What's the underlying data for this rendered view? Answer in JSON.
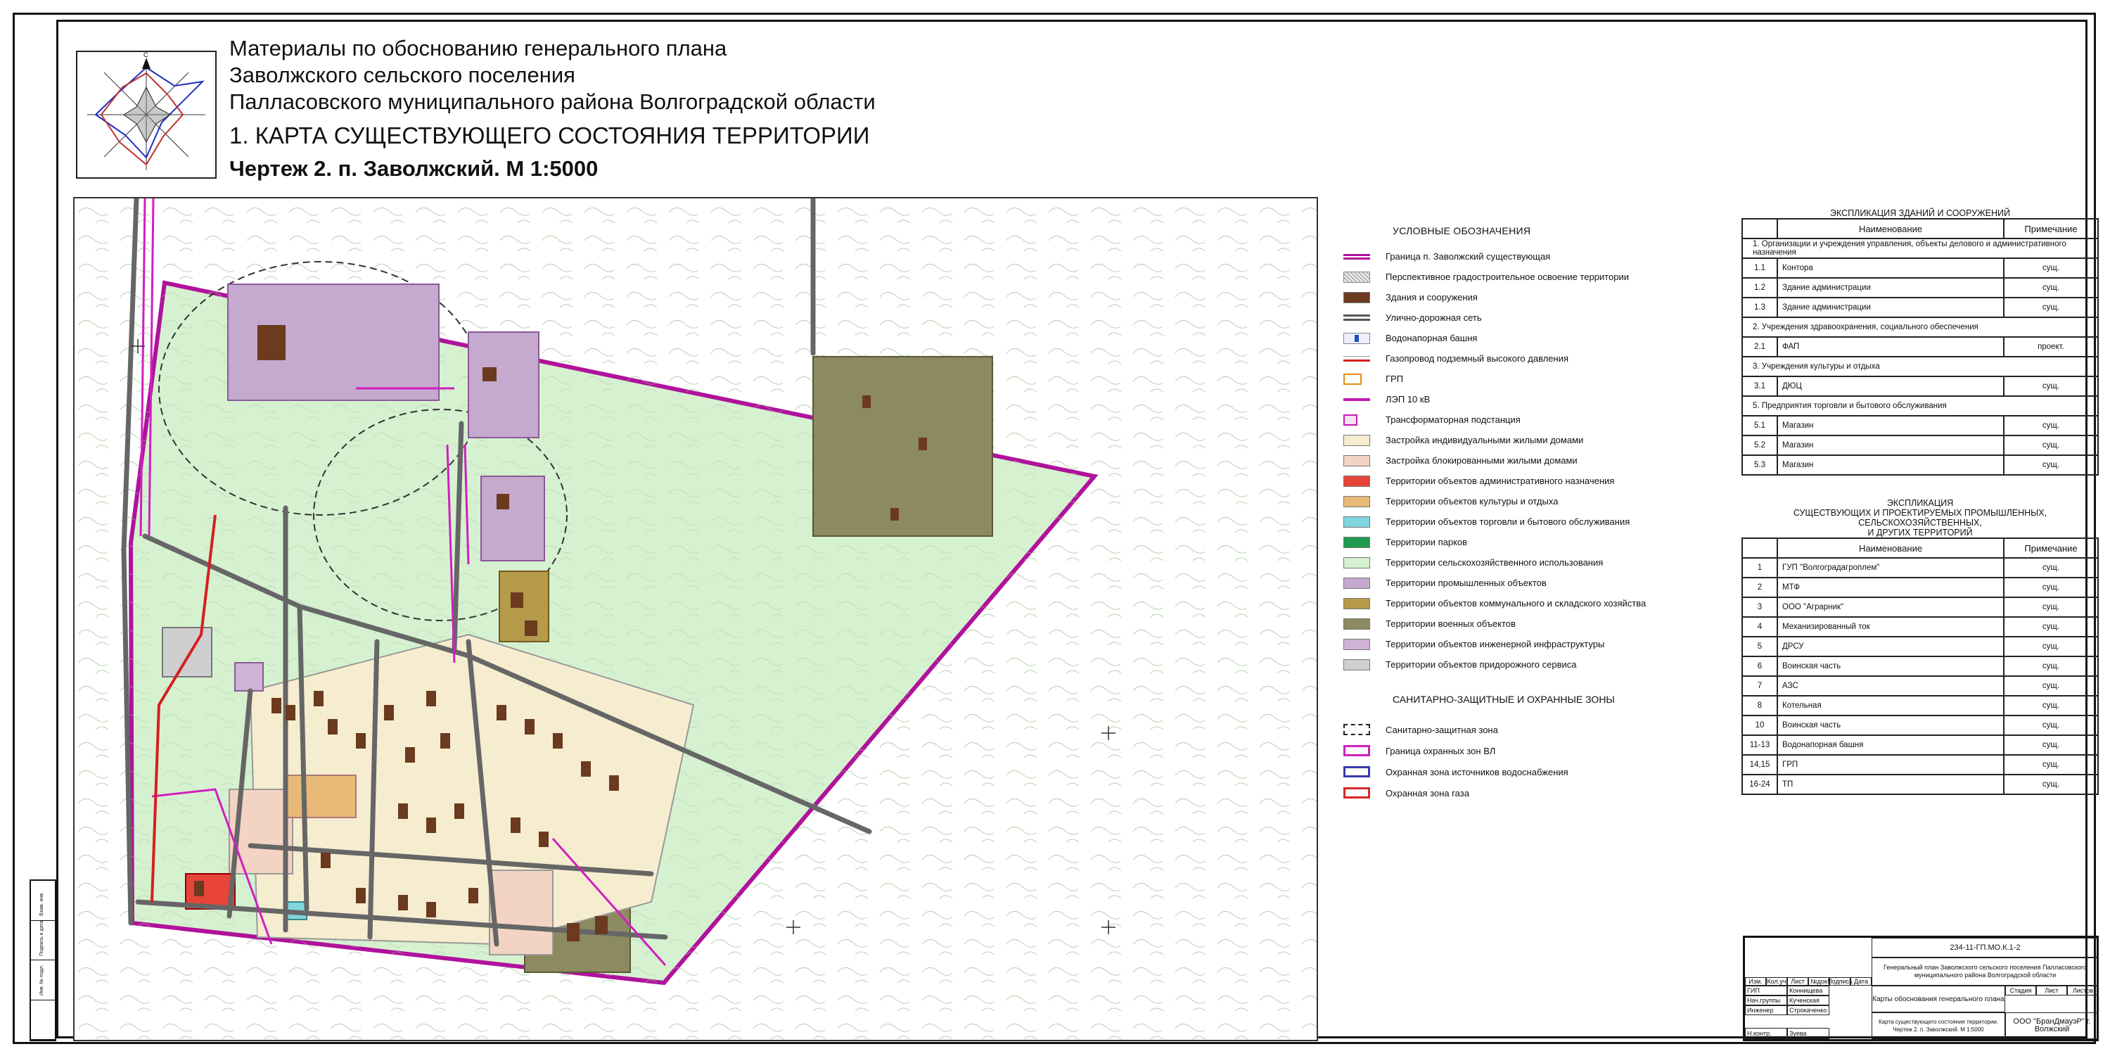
{
  "title": {
    "line1": "Материалы по обоснованию генерального плана",
    "line2": "Заволжского сельского поселения",
    "line3": "Палласовского муниципального района Волгоградской области",
    "map_name": "1. КАРТА СУЩЕСТВУЮЩЕГО СОСТОЯНИЯ ТЕРРИТОРИИ",
    "sheet": "Чертеж 2. п. Заволжский. М 1:5000"
  },
  "wind_rose": {
    "north_label": "С"
  },
  "legend": {
    "heading": "УСЛОВНЫЕ ОБОЗНАЧЕНИЯ",
    "items": [
      {
        "label": "Граница п. Заволжский существующая",
        "swatch": "boundary",
        "color": "#b0129c"
      },
      {
        "label": "Перспективное градостроительное освоение территории",
        "swatch": "hatch",
        "color": "#bdbdbd"
      },
      {
        "label": "Здания и сооружения",
        "swatch": "fill",
        "color": "#6b3a1f"
      },
      {
        "label": "Улично-дорожная сеть",
        "swatch": "road",
        "color": "#555555"
      },
      {
        "label": "Водонапорная башня",
        "swatch": "tower",
        "color": "#1f4fbf"
      },
      {
        "label": "Газопровод подземный высокого давления",
        "swatch": "gas",
        "color": "#d61f1f"
      },
      {
        "label": "ГРП",
        "swatch": "grp",
        "color": "#e38d18"
      },
      {
        "label": "ЛЭП 10 кВ",
        "swatch": "lep",
        "color": "#c21bb0"
      },
      {
        "label": "Трансформаторная подстанция",
        "swatch": "tp",
        "color": "#c21bb0"
      },
      {
        "label": "Застройка индивидуальными жилыми домами",
        "swatch": "fill",
        "color": "#f6edd0"
      },
      {
        "label": "Застройка блокированными жилыми домами",
        "swatch": "fill",
        "color": "#f3d3c3"
      },
      {
        "label": "Территории объектов административного назначения",
        "swatch": "fill",
        "color": "#e8443a"
      },
      {
        "label": "Территории объектов культуры и отдыха",
        "swatch": "fill",
        "color": "#e9b978"
      },
      {
        "label": "Территории объектов торговли и бытового обслуживания",
        "swatch": "fill",
        "color": "#7fd6df"
      },
      {
        "label": "Территории парков",
        "swatch": "fill",
        "color": "#1f9a50"
      },
      {
        "label": "Территории сельскохозяйственного использования",
        "swatch": "fill",
        "color": "#d6f1d0"
      },
      {
        "label": "Территории промышленных объектов",
        "swatch": "fill",
        "color": "#c5a9cf"
      },
      {
        "label": "Территории объектов коммунального и складского хозяйства",
        "swatch": "fill",
        "color": "#b59a4a"
      },
      {
        "label": "Территории военных объектов",
        "swatch": "fill",
        "color": "#8c8a60"
      },
      {
        "label": "Территории объектов инженерной инфраструктуры",
        "swatch": "fill",
        "color": "#cfb3d6"
      },
      {
        "label": "Территории объектов придорожного сервиса",
        "swatch": "fill",
        "color": "#cfcfcf"
      }
    ]
  },
  "zones": {
    "heading": "САНИТАРНО-ЗАЩИТНЫЕ И ОХРАННЫЕ ЗОНЫ",
    "items": [
      {
        "label": "Санитарно-защитная зона",
        "swatch": "dashed",
        "color": "#222222"
      },
      {
        "label": "Граница охранных зон ВЛ",
        "swatch": "outline",
        "color": "#d01fc0"
      },
      {
        "label": "Охранная зона источников водоснабжения",
        "swatch": "outline",
        "color": "#3a3ab0"
      },
      {
        "label": "Охранная зона газа",
        "swatch": "outline",
        "color": "#d62828"
      }
    ]
  },
  "explication_buildings": {
    "title": "ЭКСПЛИКАЦИЯ ЗДАНИЙ И СООРУЖЕНИЙ",
    "col_name": "Наименование",
    "col_note": "Примечание",
    "rows": [
      {
        "section": "1. Организации и учреждения управления, объекты делового и административного назначения"
      },
      {
        "num": "1.1",
        "name": "Контора",
        "note": "сущ."
      },
      {
        "num": "1.2",
        "name": "Здание администрации",
        "note": "сущ."
      },
      {
        "num": "1.3",
        "name": "Здание администрации",
        "note": "сущ."
      },
      {
        "section": "2. Учреждения здравоохранения, социального обеспечения"
      },
      {
        "num": "2.1",
        "name": "ФАП",
        "note": "проект."
      },
      {
        "section": "3. Учреждения культуры и отдыха"
      },
      {
        "num": "3.1",
        "name": "ДЮЦ",
        "note": "сущ."
      },
      {
        "section": "5. Предприятия торговли и бытового обслуживания"
      },
      {
        "num": "5.1",
        "name": "Магазин",
        "note": "сущ."
      },
      {
        "num": "5.2",
        "name": "Магазин",
        "note": "сущ."
      },
      {
        "num": "5.3",
        "name": "Магазин",
        "note": "сущ."
      }
    ]
  },
  "explication_territories": {
    "title_line1": "ЭКСПЛИКАЦИЯ",
    "title_line2": "СУЩЕСТВУЮЩИХ И ПРОЕКТИРУЕМЫХ ПРОМЫШЛЕННЫХ, СЕЛЬСКОХОЗЯЙСТВЕННЫХ,",
    "title_line3": "И ДРУГИХ ТЕРРИТОРИЙ",
    "col_name": "Наименование",
    "col_note": "Примечание",
    "rows": [
      {
        "num": "1",
        "name": "ГУП \"Волгоградагроплем\"",
        "note": "сущ."
      },
      {
        "num": "2",
        "name": "МТФ",
        "note": "сущ."
      },
      {
        "num": "3",
        "name": "ООО \"Аграрник\"",
        "note": "сущ."
      },
      {
        "num": "4",
        "name": "Механизированный ток",
        "note": "сущ."
      },
      {
        "num": "5",
        "name": "ДРСУ",
        "note": "сущ."
      },
      {
        "num": "6",
        "name": "Воинская часть",
        "note": "сущ."
      },
      {
        "num": "7",
        "name": "АЗС",
        "note": "сущ."
      },
      {
        "num": "8",
        "name": "Котельная",
        "note": "сущ."
      },
      {
        "num": "10",
        "name": "Воинская часть",
        "note": "сущ."
      },
      {
        "num": "11-13",
        "name": "Водонапорная башня",
        "note": "сущ."
      },
      {
        "num": "14,15",
        "name": "ГРП",
        "note": "сущ."
      },
      {
        "num": "16-24",
        "name": "ТП",
        "note": "сущ."
      }
    ]
  },
  "stamp": {
    "code": "234-11-ГП.МО.К.1-2",
    "project": "Генеральный план Заволжского сельского поселения Палласовского муниципального района Волгоградской области",
    "headers": [
      "Изм.",
      "Кол.уч",
      "Лист",
      "№док",
      "Подпись",
      "Дата"
    ],
    "roles": [
      {
        "role": "ГИП",
        "name": "Коннищева"
      },
      {
        "role": "Нач.группы",
        "name": "Кученская"
      },
      {
        "role": "Инженер",
        "name": "Строкаченко"
      },
      {
        "role": "Н.контр.",
        "name": "Зуева"
      }
    ],
    "doc_name": "Карты обоснования генерального плана",
    "stage_headers": [
      "Стадия",
      "Лист",
      "Листов"
    ],
    "sheet_name": "Карта существующего состояния территории. Чертеж 2. п. Заволжский. М 1:5000",
    "org": "ООО \"БранДмауэР\" г. Волжский"
  },
  "side_strip": [
    "Взам. инв.",
    "Подпись и дата",
    "Инв. № подл."
  ]
}
